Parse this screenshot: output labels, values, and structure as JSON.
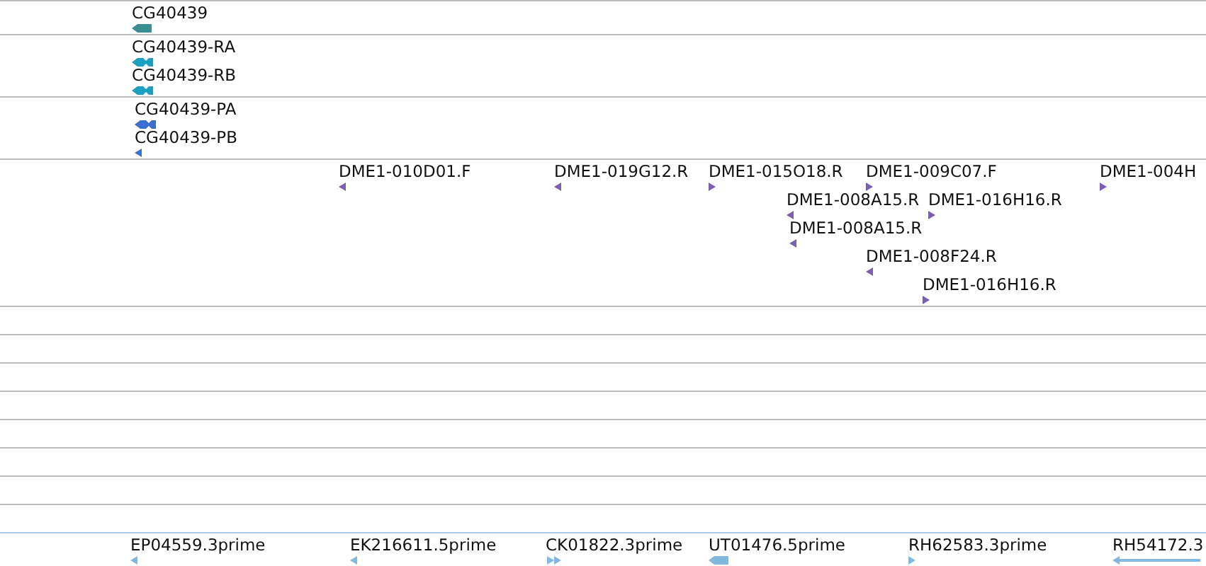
{
  "tracks": [
    {
      "kind": "features",
      "color": "#3a8f94",
      "rows": [
        [
          {
            "label": "CG40439",
            "kind": "arrow",
            "reverse": true
          }
        ]
      ]
    },
    {
      "kind": "features",
      "color": "#1aa0c0",
      "rows": [
        [
          {
            "label": "CG40439-RA",
            "kind": "transcript",
            "reverse": true
          }
        ],
        [
          {
            "label": "CG40439-RB",
            "kind": "transcript",
            "reverse": true
          }
        ]
      ]
    },
    {
      "kind": "features",
      "color": "#3a6fd0",
      "rows": [
        [
          {
            "label": "CG40439-PA",
            "kind": "transcript",
            "reverse": true
          }
        ],
        [
          {
            "label": "CG40439-PB",
            "kind": "small",
            "reverse": true
          }
        ]
      ]
    },
    {
      "kind": "features",
      "color": "#7a5fb0",
      "rows": [
        [
          {
            "label": "DME1-010D01.F",
            "kind": "small",
            "reverse": true
          },
          {
            "label": "DME1-019G12.R",
            "kind": "small",
            "reverse": true
          },
          {
            "label": "DME1-015O18.R",
            "kind": "small",
            "reverse": false
          },
          {
            "label": "DME1-009C07.F",
            "kind": "small",
            "reverse": false
          },
          {
            "label": "DME1-004H",
            "kind": "small",
            "reverse": false
          }
        ],
        [
          {
            "label": "DME1-008A15.R",
            "kind": "small",
            "reverse": true
          },
          {
            "label": "DME1-016H16.R",
            "kind": "small",
            "reverse": false
          }
        ],
        [
          {
            "label": "DME1-008A15.R",
            "kind": "small",
            "reverse": true
          }
        ],
        [
          {
            "label": "DME1-008F24.R",
            "kind": "small",
            "reverse": true
          }
        ],
        [
          {
            "label": "DME1-016H16.R",
            "kind": "small",
            "reverse": false
          }
        ]
      ]
    },
    {
      "kind": "empty"
    },
    {
      "kind": "empty"
    },
    {
      "kind": "empty"
    },
    {
      "kind": "empty"
    },
    {
      "kind": "empty"
    },
    {
      "kind": "empty"
    },
    {
      "kind": "empty"
    },
    {
      "kind": "empty"
    },
    {
      "kind": "features",
      "color": "#80b8e0",
      "rows": [
        [
          {
            "label": "EP04559.3prime",
            "kind": "small",
            "reverse": true
          },
          {
            "label": "EK216611.5prime",
            "kind": "small",
            "reverse": true
          },
          {
            "label": "CK01822.3prime",
            "kind": "double",
            "reverse": false
          },
          {
            "label": "UT01476.5prime",
            "kind": "arrow",
            "reverse": true
          },
          {
            "label": "RH62583.3prime",
            "kind": "small",
            "reverse": false
          },
          {
            "label": "RH54172.3",
            "kind": "long",
            "reverse": true
          }
        ]
      ]
    }
  ]
}
